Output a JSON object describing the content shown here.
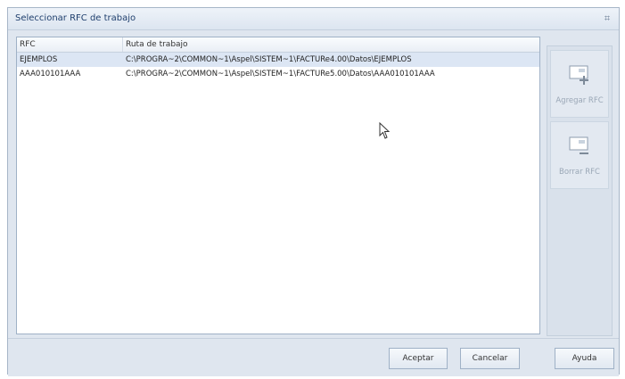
{
  "window": {
    "title": "Seleccionar RFC de trabajo",
    "close_glyph": "⌗"
  },
  "grid": {
    "columns": [
      "RFC",
      "Ruta de trabajo"
    ],
    "rows": [
      {
        "rfc": "EJEMPLOS",
        "ruta": "C:\\PROGRA~2\\COMMON~1\\Aspel\\SISTEM~1\\FACTURe4.00\\Datos\\EJEMPLOS",
        "selected": true
      },
      {
        "rfc": "AAA010101AAA",
        "ruta": "C:\\PROGRA~2\\COMMON~1\\Aspel\\SISTEM~1\\FACTURe5.00\\Datos\\AAA010101AAA",
        "selected": false
      }
    ]
  },
  "side": {
    "add_label": "Agregar RFC",
    "delete_label": "Borrar RFC"
  },
  "buttons": {
    "accept": "Aceptar",
    "cancel": "Cancelar",
    "help": "Ayuda"
  },
  "colors": {
    "selected_row": "#dce6f4",
    "title_text": "#1f3f6d",
    "disabled_text": "#9aa7b6"
  }
}
